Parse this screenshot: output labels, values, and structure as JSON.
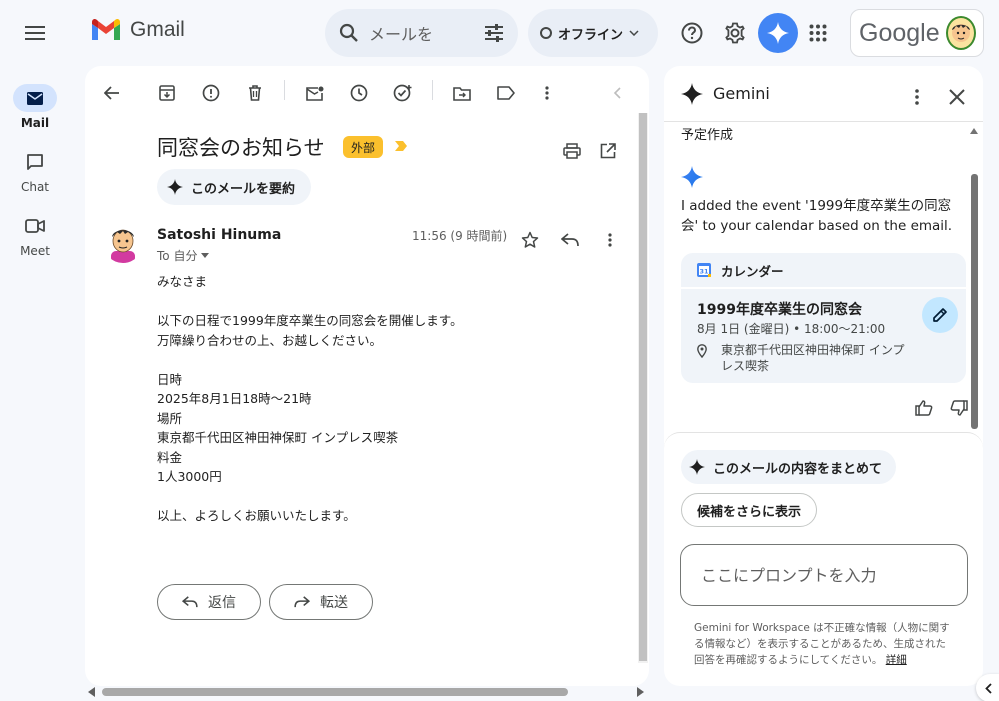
{
  "app": {
    "name": "Gmail",
    "google_label": "Google"
  },
  "search": {
    "placeholder": "メールを"
  },
  "status": {
    "offline_label": "オフライン"
  },
  "rail": [
    {
      "id": "mail",
      "label": "Mail"
    },
    {
      "id": "chat",
      "label": "Chat"
    },
    {
      "id": "meet",
      "label": "Meet"
    }
  ],
  "email": {
    "subject": "同窓会のお知らせ",
    "badge": "外部",
    "summarize_label": "このメールを要約",
    "sender_name": "Satoshi Hinuma",
    "recipient": "To 自分",
    "timestamp": "11:56 (9 時間前)",
    "body": "みなさま\n\n以下の日程で1999年度卒業生の同窓会を開催します。\n万障繰り合わせの上、お越しください。\n\n日時\n2025年8月1日18時～21時\n場所\n東京都千代田区神田神保町 インプレス喫茶\n料金\n1人3000円\n\n以上、よろしくお願いいたします。",
    "reply_label": "返信",
    "forward_label": "転送"
  },
  "gemini": {
    "title": "Gemini",
    "previous_label": "予定作成",
    "response": "I added the event '1999年度卒業生の同窓会' to your calendar based on the email.",
    "calendar": {
      "header": "カレンダー",
      "event_title": "1999年度卒業生の同窓会",
      "event_time": "8月 1日 (金曜日) • 18:00～21:00",
      "location": "東京都千代田区神田神保町 インプレス喫茶"
    },
    "suggestion_chip": "このメールの内容をまとめて",
    "more_suggestions": "候補をさらに表示",
    "prompt_placeholder": "ここにプロンプトを入力",
    "disclaimer": "Gemini for Workspace は不正確な情報（人物に関する情報など）を表示することがあるため、生成された回答を再確認するようにしてください。",
    "disclaimer_link": "詳細"
  },
  "colors": {
    "accent": "#0b57d0",
    "badge": "#fbc02d",
    "gemini_blue": "#4285f4",
    "rail_active": "#d3e3fd"
  }
}
